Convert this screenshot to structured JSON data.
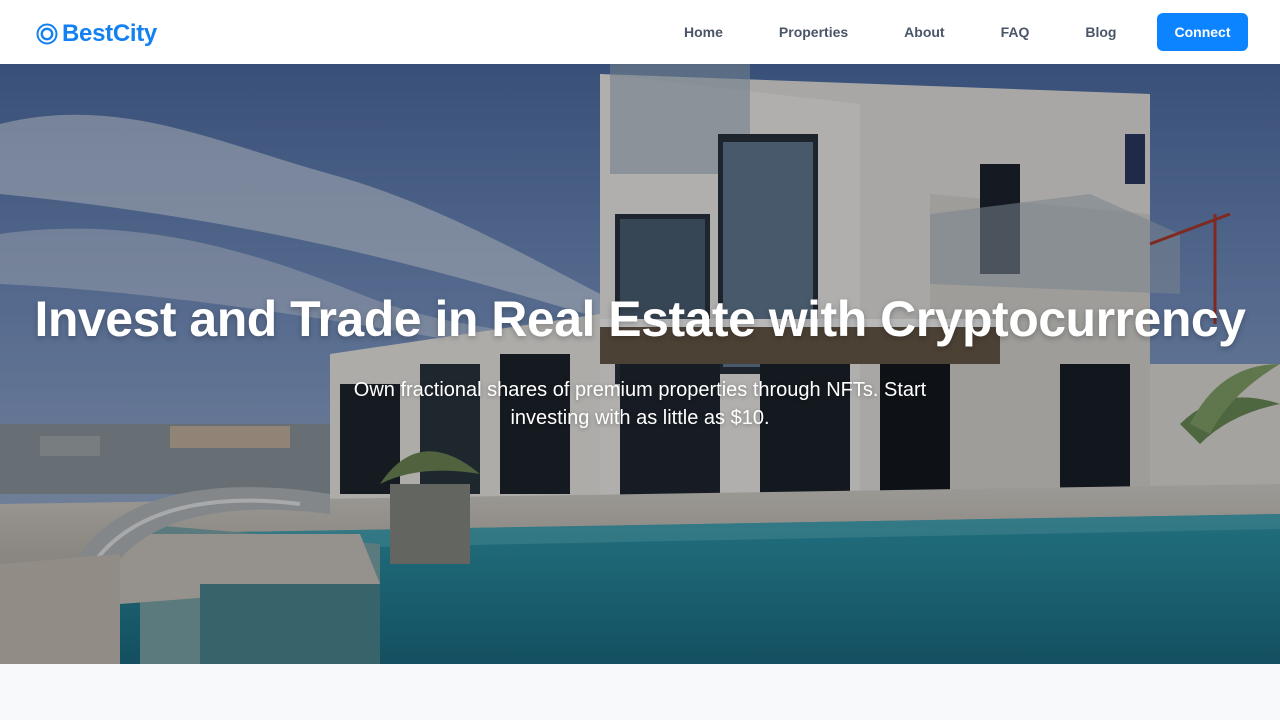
{
  "brand": {
    "name": "BestCity",
    "icon": "target-logo-icon",
    "color": "#1381f2"
  },
  "nav": {
    "items": [
      {
        "label": "Home"
      },
      {
        "label": "Properties"
      },
      {
        "label": "About"
      },
      {
        "label": "FAQ"
      },
      {
        "label": "Blog"
      }
    ],
    "connect_label": "Connect",
    "accent": "#0d84ff"
  },
  "hero": {
    "title": "Invest and Trade in Real Estate with Cryptocurrency",
    "subtitle": "Own fractional shares of premium properties through NFTs. Start investing with as little as $10.",
    "image": "modern-villa-with-pool-photo"
  }
}
